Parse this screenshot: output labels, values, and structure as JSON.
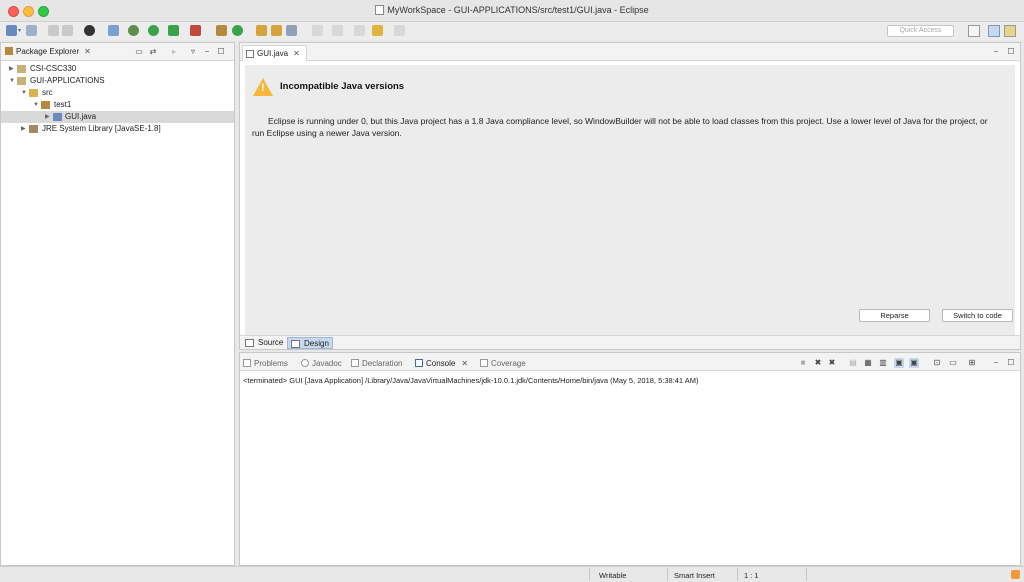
{
  "window": {
    "title": "MyWorkSpace - GUI-APPLICATIONS/src/test1/GUI.java - Eclipse"
  },
  "toolbar": {
    "quick_access_placeholder": "Quick Access"
  },
  "package_explorer": {
    "tab_label": "Package Explorer",
    "tree": [
      {
        "label": "CSI-CSC330",
        "depth": 0,
        "expanded": false
      },
      {
        "label": "GUI-APPLICATIONS",
        "depth": 0,
        "expanded": true
      },
      {
        "label": "src",
        "depth": 1,
        "expanded": true
      },
      {
        "label": "test1",
        "depth": 2,
        "expanded": true
      },
      {
        "label": "GUI.java",
        "depth": 3,
        "expanded": false,
        "selected": true
      },
      {
        "label": "JRE System Library [JavaSE-1.8]",
        "depth": 1,
        "expanded": false
      }
    ]
  },
  "editor": {
    "tab_label": "GUI.java",
    "warning_title": "Incompatible Java versions",
    "warning_message": "Eclipse is running under 0, but this Java project has a 1.8 Java compliance level, so WindowBuilder will not be able to load classes from this project. Use a lower level of Java for the project, or run Eclipse using a newer Java version.",
    "reparse_label": "Reparse",
    "switch_label": "Switch to code",
    "source_tab": "Source",
    "design_tab": "Design",
    "active_bottom_tab": "Design"
  },
  "console": {
    "tabs": [
      "Problems",
      "Javadoc",
      "Declaration",
      "Console",
      "Coverage"
    ],
    "active_tab": "Console",
    "output": "<terminated> GUI [Java Application] /Library/Java/JavaVirtualMachines/jdk-10.0.1.jdk/Contents/Home/bin/java (May 5, 2018, 5:38:41 AM)"
  },
  "statusbar": {
    "writable": "Writable",
    "insert_mode": "Smart Insert",
    "position": "1 : 1"
  },
  "colors": {
    "accent": "#c7d9f0",
    "warning": "#f6b73c",
    "selection": "#d9d9d9"
  }
}
